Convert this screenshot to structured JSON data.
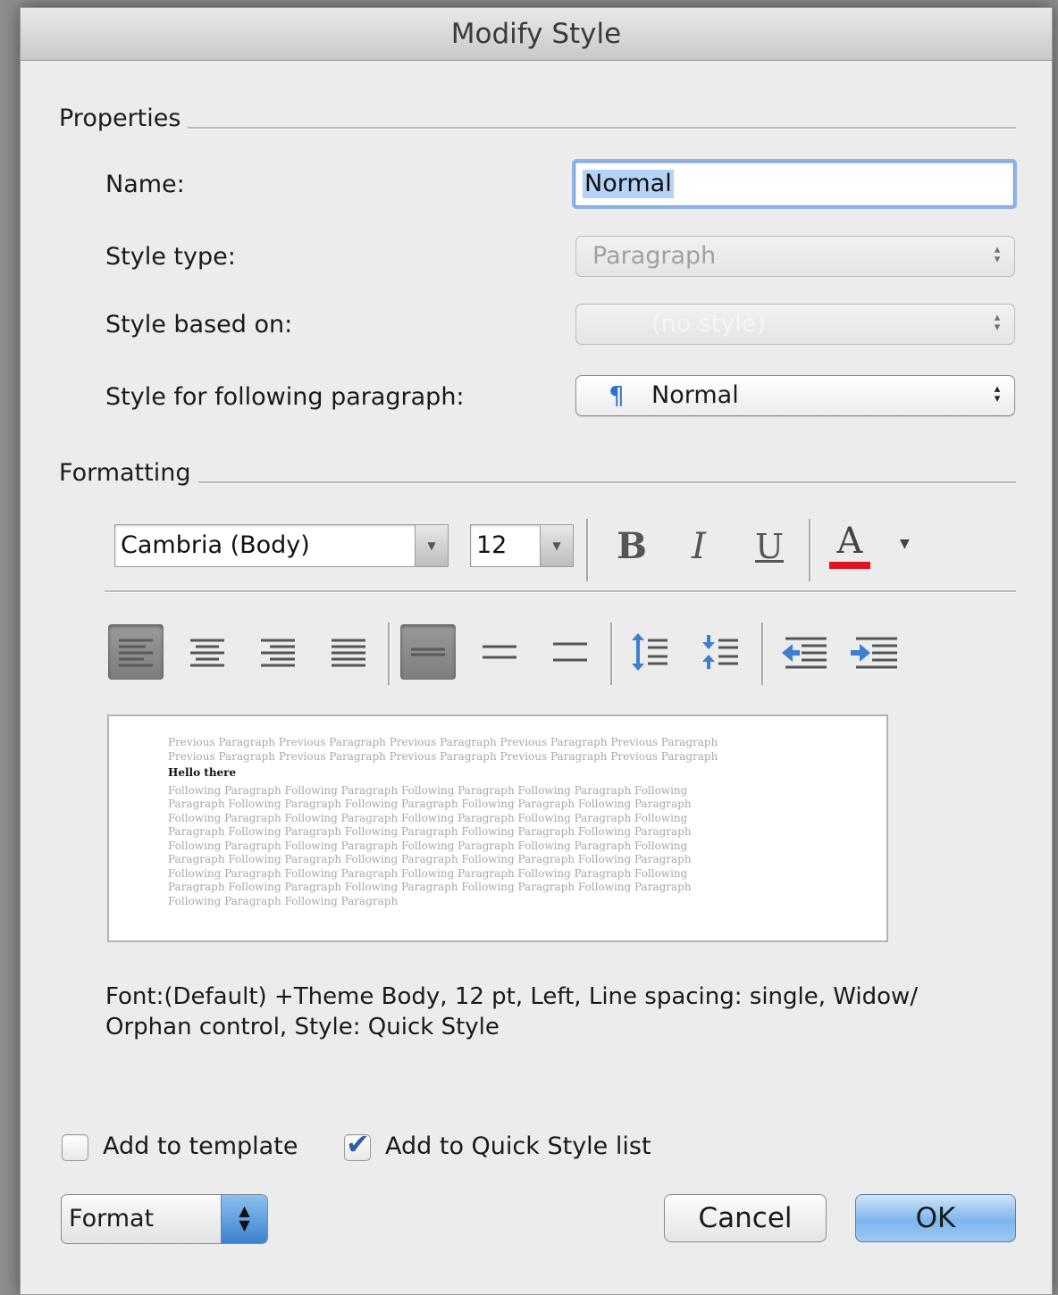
{
  "window": {
    "title": "Modify Style"
  },
  "properties": {
    "group_label": "Properties",
    "name_label": "Name:",
    "name_value": "Normal",
    "style_type_label": "Style type:",
    "style_type_value": "Paragraph",
    "based_on_label": "Style based on:",
    "based_on_value": "(no style)",
    "following_label": "Style for following paragraph:",
    "following_value": "Normal",
    "following_icon": "pilcrow-icon"
  },
  "formatting": {
    "group_label": "Formatting",
    "font_name": "Cambria (Body)",
    "font_size": "12",
    "bold_label": "B",
    "italic_label": "I",
    "underline_label": "U",
    "font_color_label": "A",
    "font_color": "#e0141e"
  },
  "preview": {
    "previous_lines": [
      "Previous Paragraph Previous Paragraph Previous Paragraph Previous Paragraph Previous Paragraph",
      "Previous Paragraph Previous Paragraph Previous Paragraph Previous Paragraph Previous Paragraph"
    ],
    "sample_text": "Hello there",
    "following_lines": [
      "Following Paragraph Following Paragraph Following Paragraph Following Paragraph Following",
      "Paragraph Following Paragraph Following Paragraph Following Paragraph Following Paragraph",
      "Following Paragraph Following Paragraph Following Paragraph Following Paragraph Following",
      "Paragraph Following Paragraph Following Paragraph Following Paragraph Following Paragraph",
      "Following Paragraph Following Paragraph Following Paragraph Following Paragraph Following",
      "Paragraph Following Paragraph Following Paragraph Following Paragraph Following Paragraph",
      "Following Paragraph Following Paragraph Following Paragraph Following Paragraph Following",
      "Paragraph Following Paragraph Following Paragraph Following Paragraph Following Paragraph",
      "Following Paragraph Following Paragraph"
    ]
  },
  "description": "Font:(Default) +Theme Body, 12 pt, Left, Line spacing:  single, Widow/ Orphan control, Style: Quick Style",
  "options": {
    "add_to_template_label": "Add to template",
    "add_to_template_checked": false,
    "quick_style_label": "Add to Quick Style list",
    "quick_style_checked": true
  },
  "buttons": {
    "format_label": "Format",
    "cancel_label": "Cancel",
    "ok_label": "OK"
  }
}
